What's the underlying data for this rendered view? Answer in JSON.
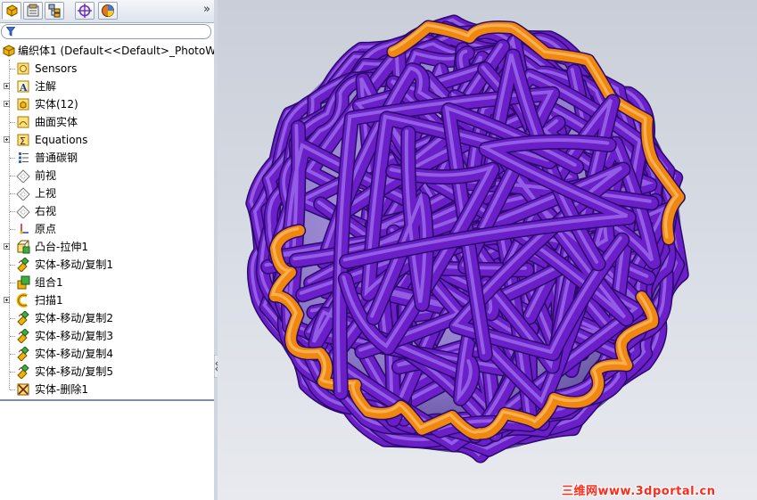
{
  "tree": {
    "root_label": "编织体1  (Default<<Default>_PhotoWo",
    "items": [
      {
        "label": "Sensors",
        "icon": "sensors-icon",
        "expandable": false
      },
      {
        "label": "注解",
        "icon": "annotations-icon",
        "expandable": true
      },
      {
        "label": "实体(12)",
        "icon": "solid-bodies-icon",
        "expandable": true
      },
      {
        "label": "曲面实体",
        "icon": "surface-bodies-icon",
        "expandable": false
      },
      {
        "label": "Equations",
        "icon": "equations-icon",
        "expandable": true
      },
      {
        "label": "普通碳钢",
        "icon": "material-icon",
        "expandable": false
      },
      {
        "label": "前视",
        "icon": "plane-icon",
        "expandable": false
      },
      {
        "label": "上视",
        "icon": "plane-icon",
        "expandable": false
      },
      {
        "label": "右视",
        "icon": "plane-icon",
        "expandable": false
      },
      {
        "label": "原点",
        "icon": "origin-icon",
        "expandable": false
      },
      {
        "label": "凸台-拉伸1",
        "icon": "extrude-icon",
        "expandable": true
      },
      {
        "label": "实体-移动/复制1",
        "icon": "move-copy-icon",
        "expandable": false
      },
      {
        "label": "组合1",
        "icon": "combine-icon",
        "expandable": false
      },
      {
        "label": "扫描1",
        "icon": "sweep-icon",
        "expandable": true
      },
      {
        "label": "实体-移动/复制2",
        "icon": "move-copy-icon",
        "expandable": false
      },
      {
        "label": "实体-移动/复制3",
        "icon": "move-copy-icon",
        "expandable": false
      },
      {
        "label": "实体-移动/复制4",
        "icon": "move-copy-icon",
        "expandable": false
      },
      {
        "label": "实体-移动/复制5",
        "icon": "move-copy-icon",
        "expandable": false
      },
      {
        "label": "实体-删除1",
        "icon": "delete-body-icon",
        "expandable": false
      }
    ]
  },
  "tabs": [
    {
      "name": "feature-manager-tab"
    },
    {
      "name": "property-manager-tab"
    },
    {
      "name": "configuration-manager-tab"
    },
    {
      "name": "dimxpert-tab"
    },
    {
      "name": "display-manager-tab"
    }
  ],
  "more_glyph": "»",
  "watermark": "三维网www.3dportal.cn",
  "colors": {
    "strand": "#6a1fc8",
    "strand_highlight": "#a477f0",
    "accent_strand": "#f0870f"
  }
}
